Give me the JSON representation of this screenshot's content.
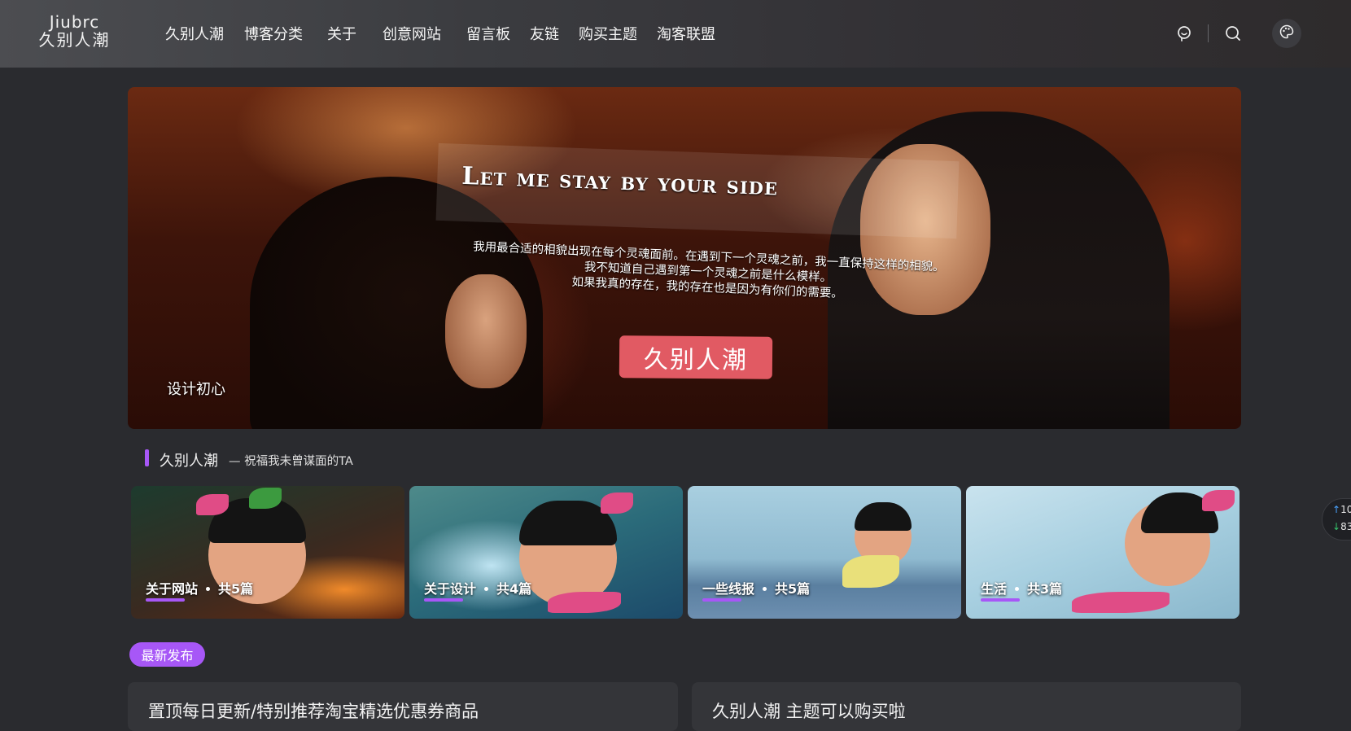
{
  "header": {
    "logo_en": "Jiubrc",
    "logo_cn": "久别人潮",
    "nav": [
      "久别人潮",
      "博客分类",
      "关于",
      "创意网站",
      "留言板",
      "友链",
      "购买主题",
      "淘客联盟"
    ],
    "icons": [
      "chat-icon",
      "search-icon",
      "palette-icon"
    ]
  },
  "hero": {
    "title": "Let me stay by your side",
    "quote_lines": [
      "我用最合适的相貌出现在每个灵魂面前。在遇到下一个灵魂之前，我一直保持这样的相貌。",
      "我不知道自己遇到第一个灵魂之前是什么模样。",
      "如果我真的存在，我的存在也是因为有你们的需要。"
    ],
    "badge": "久别人潮",
    "caption": "设计初心"
  },
  "section": {
    "title": "久别人潮",
    "subtitle": "— 祝福我未曾谋面的TA",
    "accent": "#a757f7"
  },
  "categories": [
    {
      "name": "关于网站",
      "count": "共5篇"
    },
    {
      "name": "关于设计",
      "count": "共4篇"
    },
    {
      "name": "一些线报",
      "count": "共5篇"
    },
    {
      "name": "生活",
      "count": "共3篇"
    }
  ],
  "latest": {
    "tag": "最新发布",
    "posts": [
      {
        "title": "置顶每日更新/特别推荐淘宝精选优惠券商品"
      },
      {
        "title": "久别人潮 主题可以购买啦"
      }
    ]
  },
  "float_widget": {
    "up": "10",
    "down": "83"
  }
}
